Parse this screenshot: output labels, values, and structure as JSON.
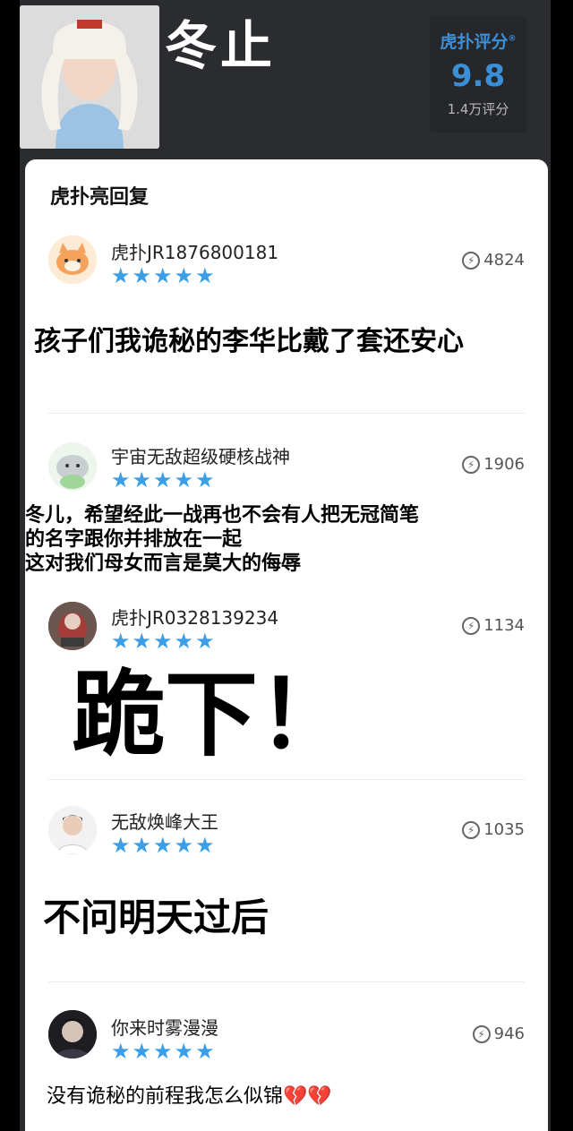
{
  "header": {
    "title": "冬止",
    "rating": {
      "brand": "虎扑评分",
      "registered": "®",
      "score": "9.8",
      "count": "1.4万评分"
    }
  },
  "card": {
    "title": "虎扑亮回复",
    "replies": [
      {
        "user": "虎扑JR1876800181",
        "stars": "★★★★★",
        "likes": "4824",
        "text": "孩子们我诡秘的李华比戴了套还安心"
      },
      {
        "user": "宇宙无敌超级硬核战神",
        "stars": "★★★★★",
        "likes": "1906",
        "text_lines": [
          "冬儿，希望经此一战再也不会有人把无冠简笔",
          "的名字跟你并排放在一起",
          "这对我们母女而言是莫大的侮辱"
        ]
      },
      {
        "user": "虎扑JR0328139234",
        "stars": "★★★★★",
        "likes": "1134",
        "text": "跪下！"
      },
      {
        "user": "无敌焕峰大王",
        "stars": "★★★★★",
        "likes": "1035",
        "text": "不问明天过后"
      },
      {
        "user": "你来时雾漫漫",
        "stars": "★★★★★",
        "likes": "946",
        "text": "没有诡秘的前程我怎么似锦💔💔"
      }
    ]
  },
  "colors": {
    "background": "#000000",
    "panel": "#2b2c2f",
    "brand_blue": "#3b8fd6",
    "star_blue": "#3a9ee8"
  }
}
